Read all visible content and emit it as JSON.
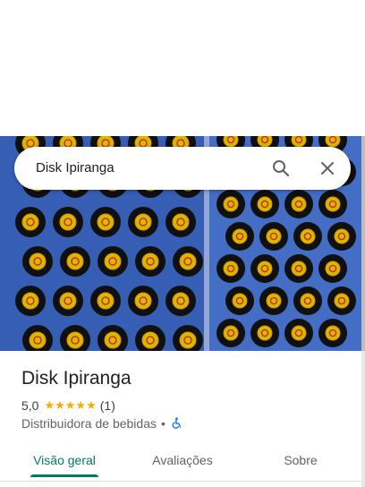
{
  "search": {
    "query": "Disk Ipiranga"
  },
  "place": {
    "name": "Disk Ipiranga",
    "rating": "5,0",
    "stars": "★★★★★",
    "review_count": "(1)",
    "category": "Distribuidora de bebidas",
    "separator": "•"
  },
  "tabs": [
    {
      "label": "Visão geral",
      "active": true
    },
    {
      "label": "Avaliações",
      "active": false
    },
    {
      "label": "Sobre",
      "active": false
    }
  ],
  "colors": {
    "accent": "#00796b",
    "star": "#f9ab00",
    "crate": "#3a6fd0",
    "cap": "#f5c400"
  },
  "icons": [
    "search-icon",
    "close-icon",
    "wheelchair-accessible-icon"
  ]
}
